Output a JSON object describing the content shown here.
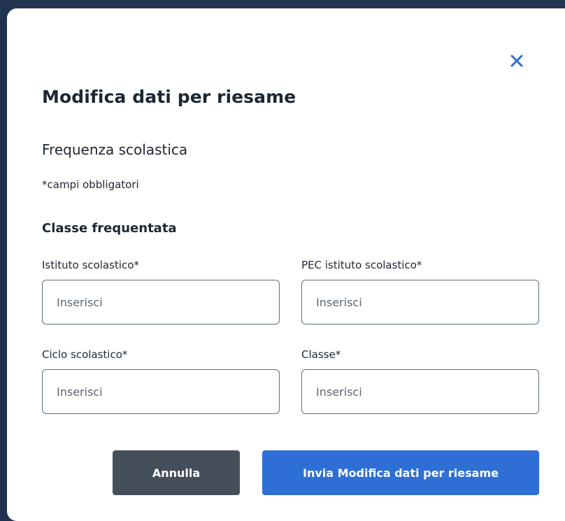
{
  "modal": {
    "title": "Modifica dati per riesame",
    "section_title": "Frequenza scolastica",
    "required_note": "*campi obbligatori",
    "subsection_title": "Classe frequentata",
    "close_icon": "close-icon",
    "accent_color": "#2e6fd6"
  },
  "fields": {
    "istituto": {
      "label": "Istituto scolastico*",
      "placeholder": "Inserisci",
      "value": ""
    },
    "pec": {
      "label": "PEC istituto scolastico*",
      "placeholder": "Inserisci",
      "value": ""
    },
    "ciclo": {
      "label": "Ciclo scolastico*",
      "placeholder": "Inserisci",
      "value": ""
    },
    "classe": {
      "label": "Classe*",
      "placeholder": "Inserisci",
      "value": ""
    }
  },
  "actions": {
    "cancel_label": "Annulla",
    "submit_label": "Invia Modifica dati per riesame",
    "cancel_color": "#454f5a",
    "submit_color": "#2e6fd6"
  }
}
